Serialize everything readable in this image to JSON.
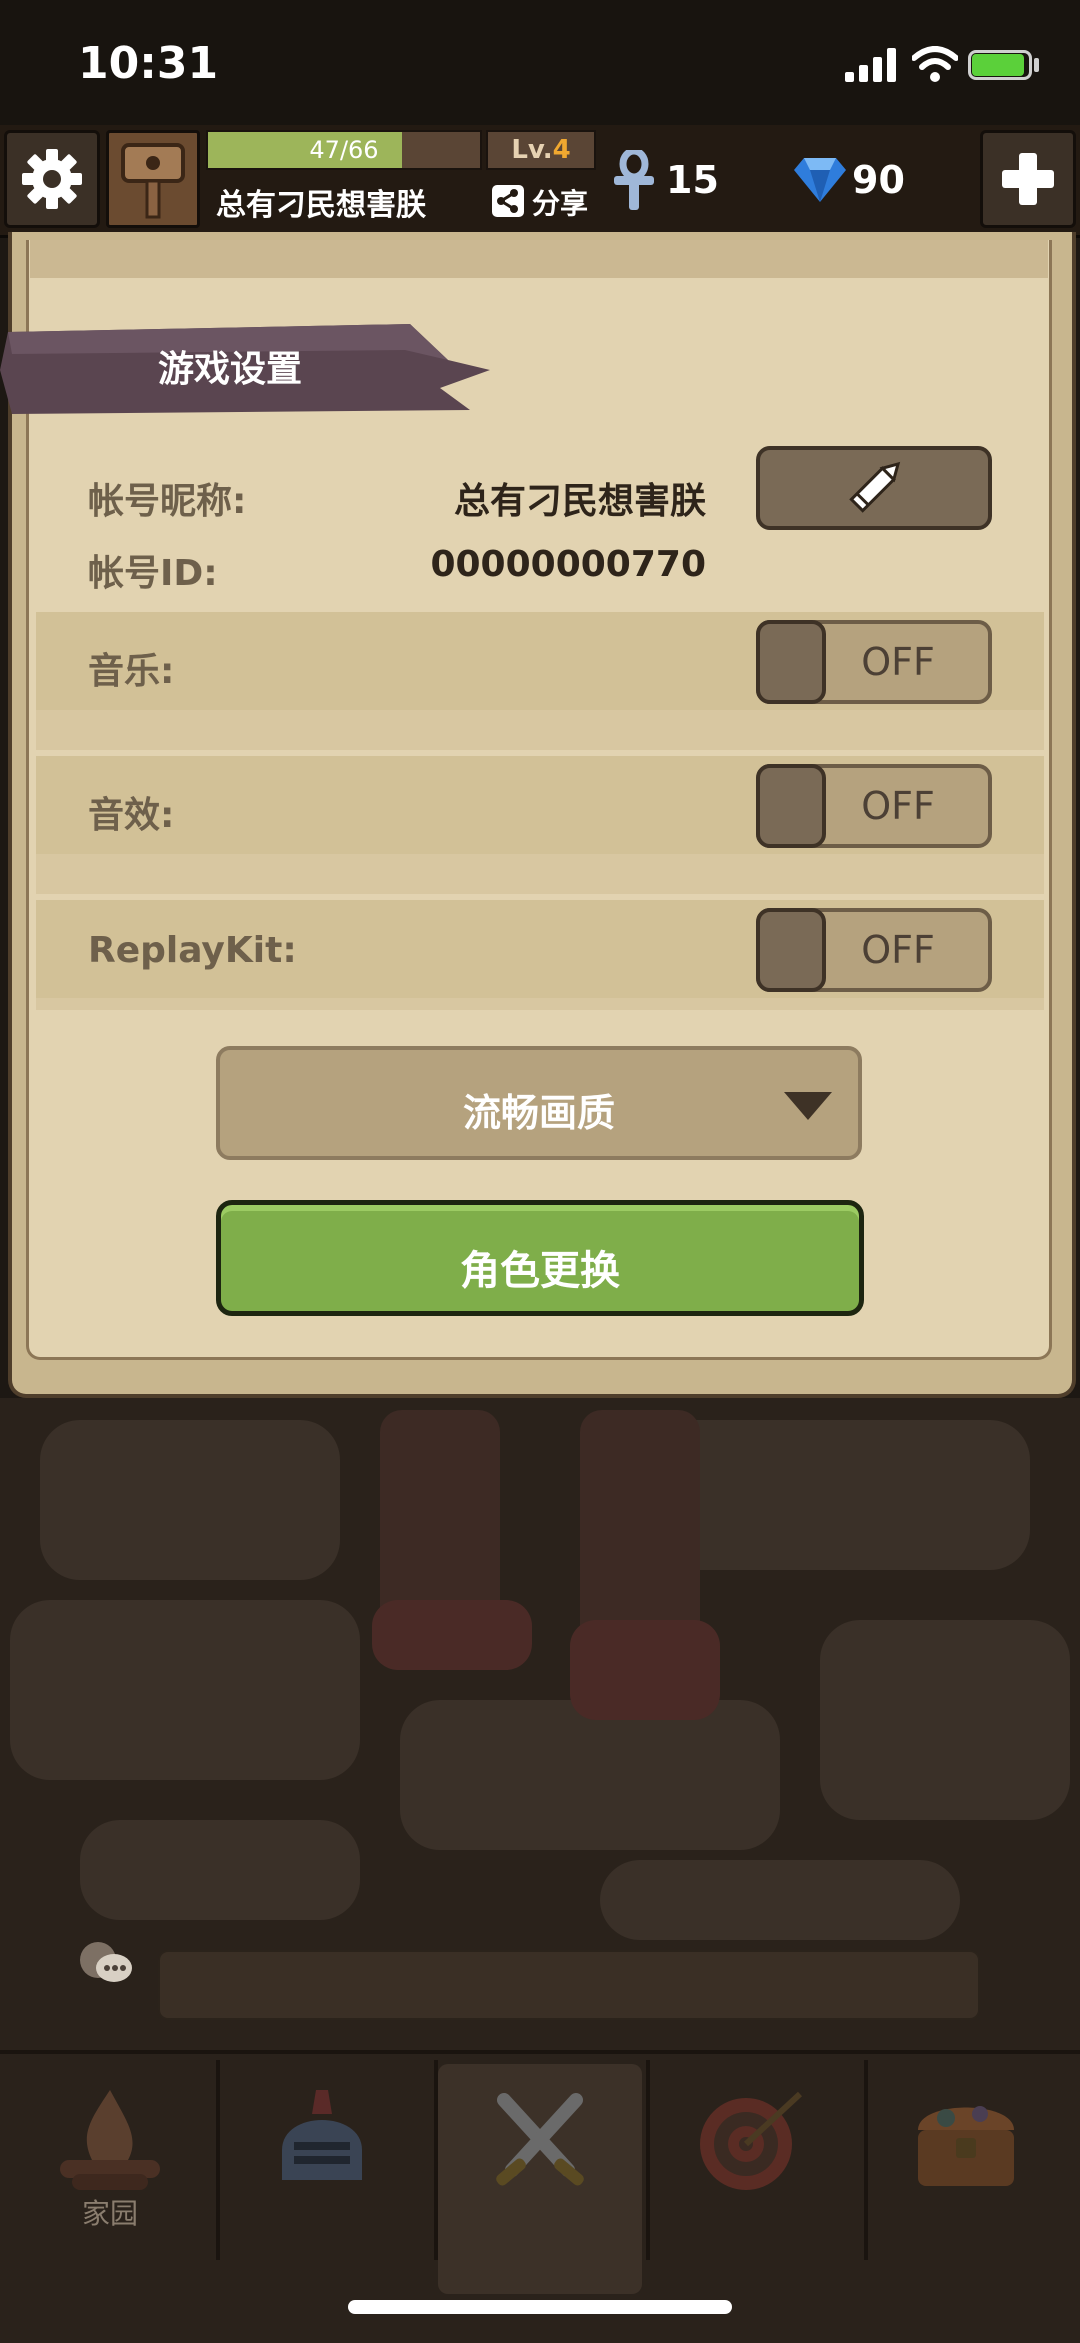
{
  "status_bar": {
    "time": "10:31"
  },
  "hud": {
    "xp_text": "47/66",
    "xp_progress": 0.712,
    "level_prefix": "Lv.",
    "level_value": "4",
    "player_name": "总有刁民想害朕",
    "share_label": "分享",
    "ankh_count": "15",
    "gem_count": "90"
  },
  "settings": {
    "title": "游戏设置",
    "nickname_label": "帐号昵称:",
    "nickname_value": "总有刁民想害朕",
    "account_id_label": "帐号ID:",
    "account_id_value": "00000000770",
    "music_label": "音乐:",
    "music_state": "OFF",
    "sfx_label": "音效:",
    "sfx_state": "OFF",
    "replaykit_label": "ReplayKit:",
    "replaykit_state": "OFF",
    "quality_value": "流畅画质",
    "change_role_label": "角色更换"
  },
  "nav": {
    "items": [
      {
        "label": "家园",
        "icon": "campfire-icon"
      },
      {
        "label": "",
        "icon": "helmet-icon"
      },
      {
        "label": "",
        "icon": "crossed-swords-icon"
      },
      {
        "label": "",
        "icon": "target-icon"
      },
      {
        "label": "",
        "icon": "treasure-chest-icon"
      }
    ]
  },
  "colors": {
    "accent_green": "#7fae4a",
    "panel_parchment": "#e2d3b1",
    "ribbon": "#5a4550"
  }
}
